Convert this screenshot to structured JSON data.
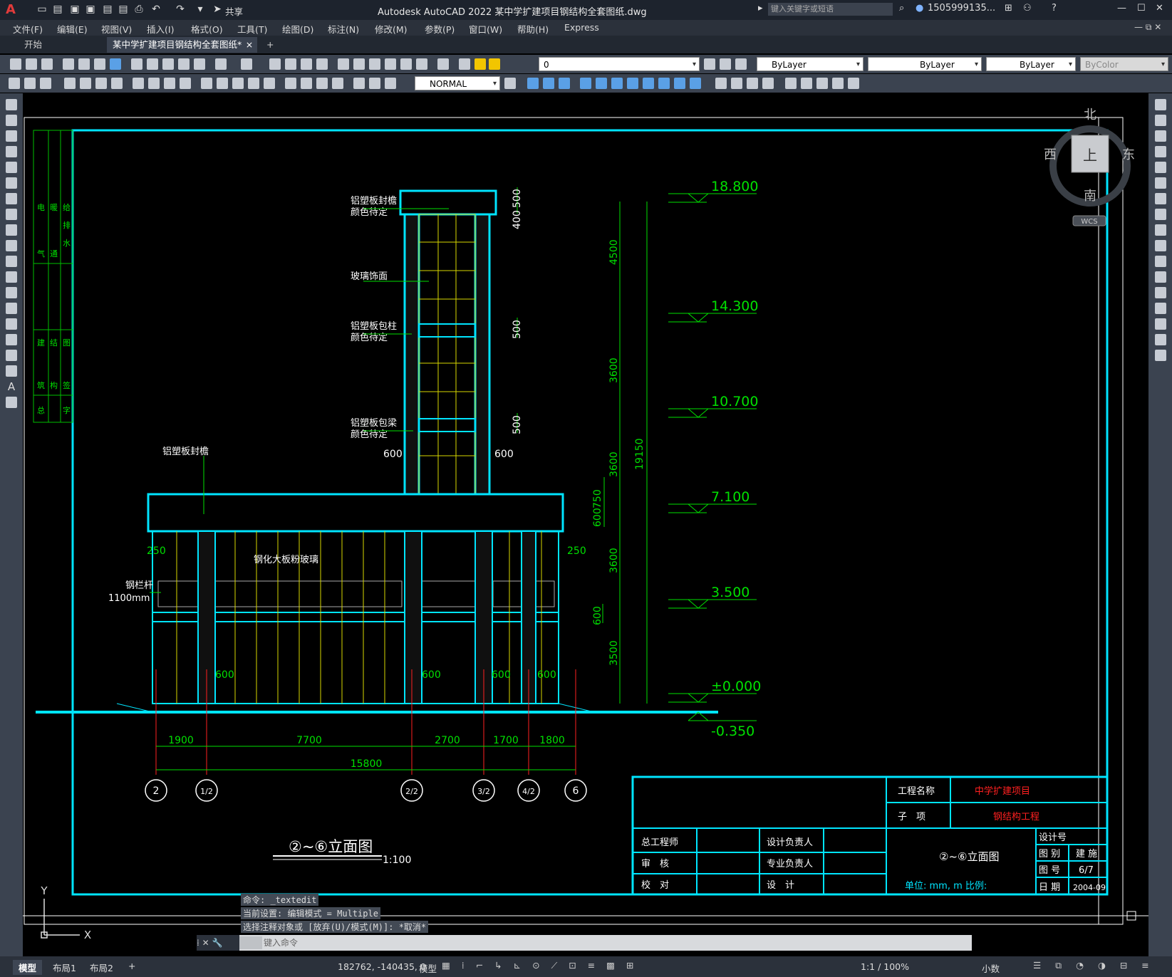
{
  "titlebar": {
    "app_title": "Autodesk AutoCAD 2022    某中学扩建项目钢结构全套图纸.dwg",
    "share_label": "共享",
    "search_placeholder": "键入关键字或短语",
    "user": "1505999135...",
    "logo": "A"
  },
  "menu": [
    "文件(F)",
    "编辑(E)",
    "视图(V)",
    "插入(I)",
    "格式(O)",
    "工具(T)",
    "绘图(D)",
    "标注(N)",
    "修改(M)",
    "参数(P)",
    "窗口(W)",
    "帮助(H)",
    "Express"
  ],
  "tabs": {
    "start": "开始",
    "document": "某中学扩建项目钢结构全套图纸*",
    "close": "×",
    "add": "+"
  },
  "toolbar": {
    "layer_value": "0",
    "color_value": "ByLayer",
    "linetype_value": "ByLayer",
    "lineweight_value": "ByLayer",
    "plotstyle_value": "ByColor",
    "dimstyle_value": "NORMAL"
  },
  "viewcube": {
    "north": "北",
    "south": "南",
    "east": "东",
    "west": "西",
    "face": "上",
    "wcs": "WCS"
  },
  "drawing": {
    "elevations": [
      "18.800",
      "14.300",
      "10.700",
      "7.100",
      "3.500",
      "±0.000",
      "-0.350"
    ],
    "left_dims": [
      "500",
      "400",
      "4500",
      "500",
      "3600",
      "500",
      "3600",
      "600",
      "750",
      "3600",
      "600",
      "3500"
    ],
    "overall_height": "19150",
    "bottom_dims": [
      "1900",
      "7700",
      "2700",
      "1700",
      "1800"
    ],
    "overall_width": "15800",
    "axes": [
      "2",
      "1/2",
      "2/2",
      "3/2",
      "4/2",
      "6"
    ],
    "labels": {
      "l1": "铝塑板封檐",
      "l1b": "颜色待定",
      "l2": "玻璃饰面",
      "l3": "铝塑板包柱",
      "l3b": "颜色待定",
      "l4": "铝塑板包梁",
      "l4b": "颜色待定",
      "l5": "铝塑板封檐",
      "l6": "钢化大板粉玻璃",
      "l7": "钢栏杆",
      "l7b": "1100mm",
      "d600a": "600",
      "d600b": "600",
      "d250a": "250",
      "d250b": "250",
      "d600c": "600",
      "d600d": "600",
      "d600e": "600",
      "d600f": "600"
    },
    "drawing_title": "②~⑥立面图",
    "scale": "1:100"
  },
  "titleblock": {
    "proj_label": "工程名称",
    "proj_value": "中学扩建项目",
    "sub_label": "子　项",
    "sub_value": "钢结构工程",
    "r1": "总工程师",
    "r2": "审　核",
    "r3": "校　对",
    "r4": "设计负责人",
    "r5": "专业负责人",
    "r6": "设　计",
    "sheet_title": "②~⑥立面图",
    "units": "单位: mm, m  比例:",
    "no_label": "设计号",
    "cat_label": "图 别",
    "cat_value": "建 施",
    "num_label": "图 号",
    "num_value": "6/7",
    "date_label": "日 期",
    "date_value": "2004-09"
  },
  "sidebox": [
    "电",
    "气",
    "暖",
    "通",
    "给",
    "排",
    "水",
    "建",
    "筑",
    "结",
    "构",
    "总",
    "图",
    "签",
    "字"
  ],
  "command": {
    "line1": "命令: _textedit",
    "line2": "当前设置: 编辑模式 = Multiple",
    "line3": "选择注释对象或 [放弃(U)/模式(M)]: *取消*",
    "input_placeholder": "键入命令"
  },
  "ucs": {
    "y": "Y",
    "x": "X"
  },
  "status": {
    "tab_model": "模型",
    "tab_layout1": "布局1",
    "tab_layout2": "布局2",
    "add": "+",
    "coords": "182762, -140435, 0",
    "space": "模型",
    "scale": "1:1 / 100%",
    "units": "小数"
  }
}
